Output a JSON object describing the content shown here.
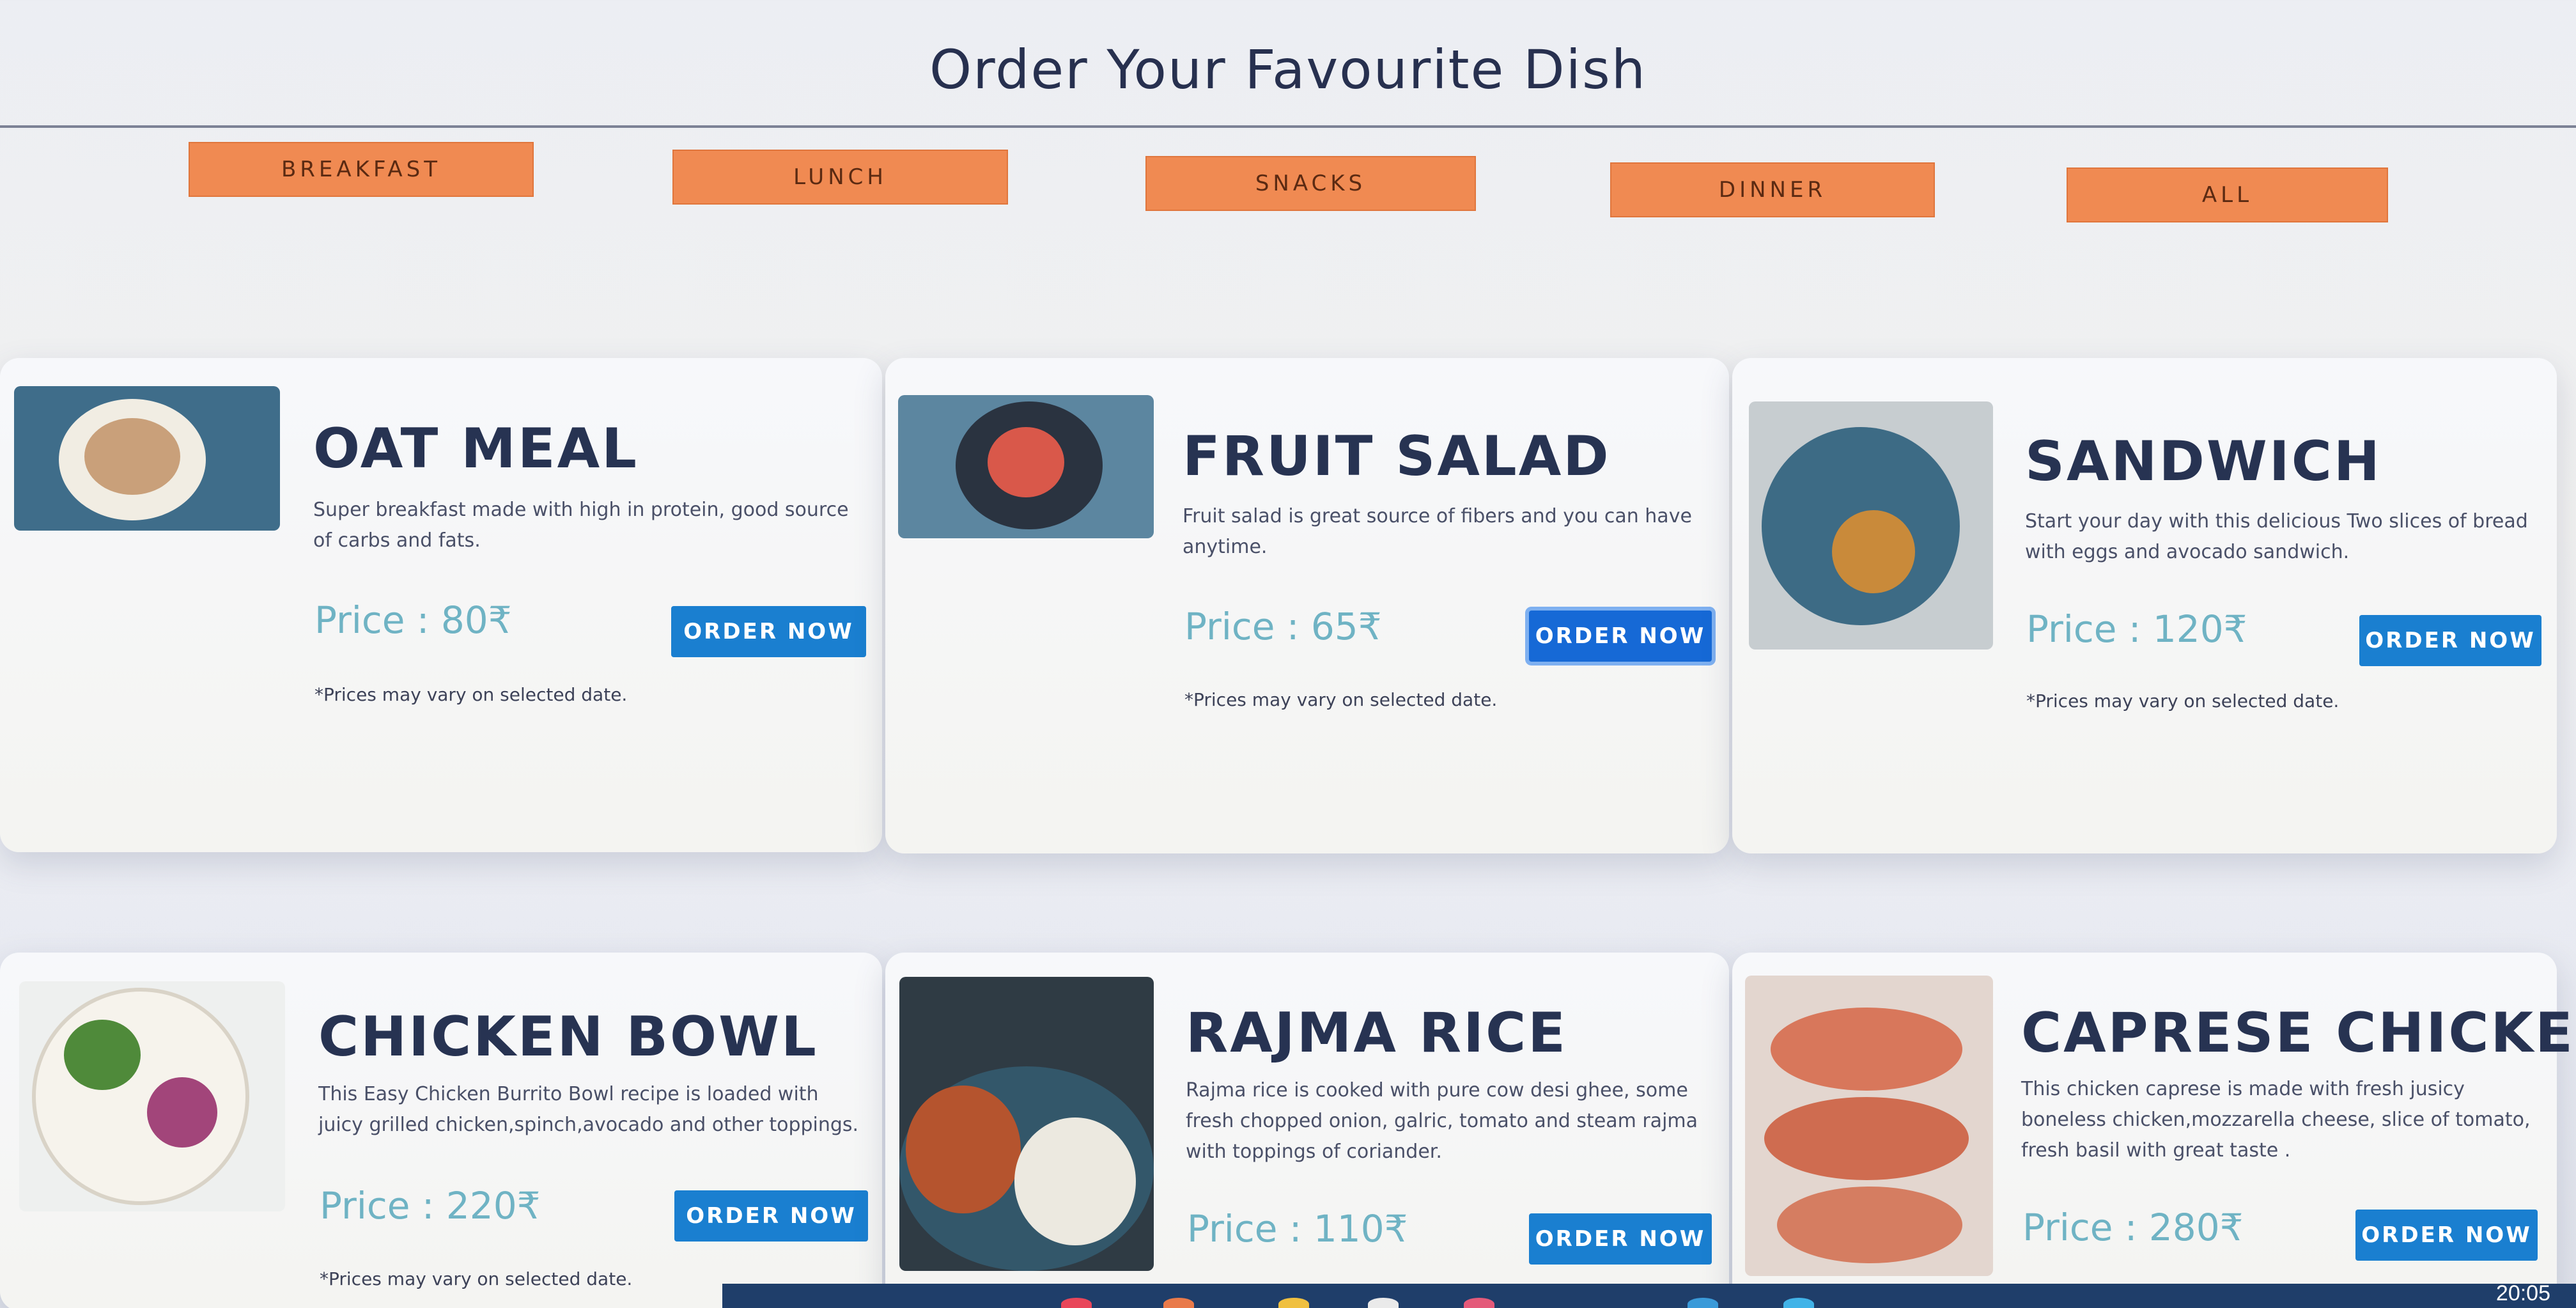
{
  "header": {
    "title": "Order Your Favourite Dish"
  },
  "categories": [
    "BREAKFAST",
    "LUNCH",
    "SNACKS",
    "DINNER",
    "ALL"
  ],
  "dishes": [
    {
      "name": "OAT MEAL",
      "description": "Super breakfast made with high in protein, good source of carbs and fats.",
      "price": "Price : 80₹",
      "button": "ORDER NOW",
      "note": "*Prices may vary on selected date."
    },
    {
      "name": "FRUIT SALAD",
      "description": "Fruit salad is great source of fibers and you can have anytime.",
      "price": "Price : 65₹",
      "button": "ORDER NOW",
      "note": "*Prices may vary on selected date."
    },
    {
      "name": "SANDWICH",
      "description": "Start your day with this delicious Two slices of bread with eggs and avocado sandwich.",
      "price": "Price : 120₹",
      "button": "ORDER NOW",
      "note": "*Prices may vary on selected date."
    },
    {
      "name": "CHICKEN BOWL",
      "description": "This Easy Chicken Burrito Bowl recipe is loaded with juicy grilled chicken,spinch,avocado and other toppings.",
      "price": "Price : 220₹",
      "button": "ORDER NOW",
      "note": "*Prices may vary on selected date."
    },
    {
      "name": "RAJMA RICE",
      "description": "Rajma rice is cooked with pure cow desi ghee, some fresh chopped onion, galric, tomato and steam rajma with toppings of coriander.",
      "price": "Price : 110₹",
      "button": "ORDER NOW"
    },
    {
      "name": "CAPRESE CHICKEN",
      "description": "This chicken caprese is made with fresh jusicy boneless chicken,mozzarella cheese, slice of tomato, fresh basil with great taste .",
      "price": "Price : 280₹",
      "button": "ORDER NOW"
    }
  ],
  "taskbar": {
    "clock": "20:05"
  },
  "colors": {
    "accent": "#f08a52",
    "button": "#1a7fd0",
    "title": "#27304f",
    "price": "#6fb3c4"
  }
}
